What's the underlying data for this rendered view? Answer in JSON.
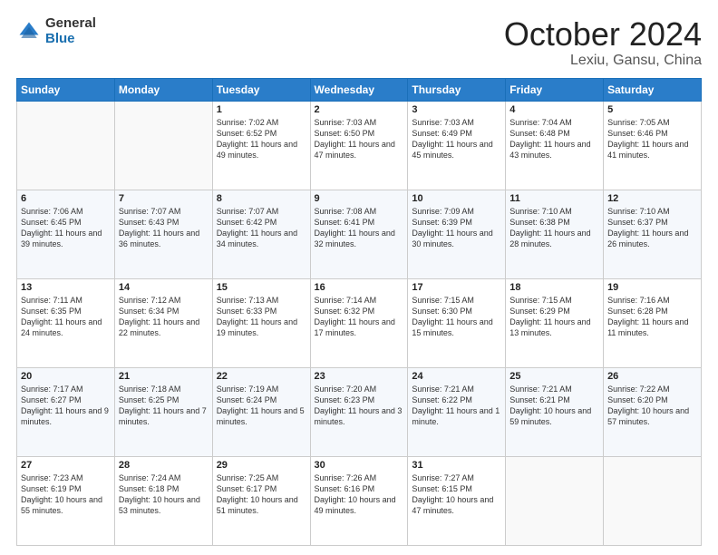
{
  "logo": {
    "general": "General",
    "blue": "Blue"
  },
  "header": {
    "month": "October 2024",
    "location": "Lexiu, Gansu, China"
  },
  "weekdays": [
    "Sunday",
    "Monday",
    "Tuesday",
    "Wednesday",
    "Thursday",
    "Friday",
    "Saturday"
  ],
  "weeks": [
    [
      {
        "day": "",
        "text": ""
      },
      {
        "day": "",
        "text": ""
      },
      {
        "day": "1",
        "text": "Sunrise: 7:02 AM\nSunset: 6:52 PM\nDaylight: 11 hours and 49 minutes."
      },
      {
        "day": "2",
        "text": "Sunrise: 7:03 AM\nSunset: 6:50 PM\nDaylight: 11 hours and 47 minutes."
      },
      {
        "day": "3",
        "text": "Sunrise: 7:03 AM\nSunset: 6:49 PM\nDaylight: 11 hours and 45 minutes."
      },
      {
        "day": "4",
        "text": "Sunrise: 7:04 AM\nSunset: 6:48 PM\nDaylight: 11 hours and 43 minutes."
      },
      {
        "day": "5",
        "text": "Sunrise: 7:05 AM\nSunset: 6:46 PM\nDaylight: 11 hours and 41 minutes."
      }
    ],
    [
      {
        "day": "6",
        "text": "Sunrise: 7:06 AM\nSunset: 6:45 PM\nDaylight: 11 hours and 39 minutes."
      },
      {
        "day": "7",
        "text": "Sunrise: 7:07 AM\nSunset: 6:43 PM\nDaylight: 11 hours and 36 minutes."
      },
      {
        "day": "8",
        "text": "Sunrise: 7:07 AM\nSunset: 6:42 PM\nDaylight: 11 hours and 34 minutes."
      },
      {
        "day": "9",
        "text": "Sunrise: 7:08 AM\nSunset: 6:41 PM\nDaylight: 11 hours and 32 minutes."
      },
      {
        "day": "10",
        "text": "Sunrise: 7:09 AM\nSunset: 6:39 PM\nDaylight: 11 hours and 30 minutes."
      },
      {
        "day": "11",
        "text": "Sunrise: 7:10 AM\nSunset: 6:38 PM\nDaylight: 11 hours and 28 minutes."
      },
      {
        "day": "12",
        "text": "Sunrise: 7:10 AM\nSunset: 6:37 PM\nDaylight: 11 hours and 26 minutes."
      }
    ],
    [
      {
        "day": "13",
        "text": "Sunrise: 7:11 AM\nSunset: 6:35 PM\nDaylight: 11 hours and 24 minutes."
      },
      {
        "day": "14",
        "text": "Sunrise: 7:12 AM\nSunset: 6:34 PM\nDaylight: 11 hours and 22 minutes."
      },
      {
        "day": "15",
        "text": "Sunrise: 7:13 AM\nSunset: 6:33 PM\nDaylight: 11 hours and 19 minutes."
      },
      {
        "day": "16",
        "text": "Sunrise: 7:14 AM\nSunset: 6:32 PM\nDaylight: 11 hours and 17 minutes."
      },
      {
        "day": "17",
        "text": "Sunrise: 7:15 AM\nSunset: 6:30 PM\nDaylight: 11 hours and 15 minutes."
      },
      {
        "day": "18",
        "text": "Sunrise: 7:15 AM\nSunset: 6:29 PM\nDaylight: 11 hours and 13 minutes."
      },
      {
        "day": "19",
        "text": "Sunrise: 7:16 AM\nSunset: 6:28 PM\nDaylight: 11 hours and 11 minutes."
      }
    ],
    [
      {
        "day": "20",
        "text": "Sunrise: 7:17 AM\nSunset: 6:27 PM\nDaylight: 11 hours and 9 minutes."
      },
      {
        "day": "21",
        "text": "Sunrise: 7:18 AM\nSunset: 6:25 PM\nDaylight: 11 hours and 7 minutes."
      },
      {
        "day": "22",
        "text": "Sunrise: 7:19 AM\nSunset: 6:24 PM\nDaylight: 11 hours and 5 minutes."
      },
      {
        "day": "23",
        "text": "Sunrise: 7:20 AM\nSunset: 6:23 PM\nDaylight: 11 hours and 3 minutes."
      },
      {
        "day": "24",
        "text": "Sunrise: 7:21 AM\nSunset: 6:22 PM\nDaylight: 11 hours and 1 minute."
      },
      {
        "day": "25",
        "text": "Sunrise: 7:21 AM\nSunset: 6:21 PM\nDaylight: 10 hours and 59 minutes."
      },
      {
        "day": "26",
        "text": "Sunrise: 7:22 AM\nSunset: 6:20 PM\nDaylight: 10 hours and 57 minutes."
      }
    ],
    [
      {
        "day": "27",
        "text": "Sunrise: 7:23 AM\nSunset: 6:19 PM\nDaylight: 10 hours and 55 minutes."
      },
      {
        "day": "28",
        "text": "Sunrise: 7:24 AM\nSunset: 6:18 PM\nDaylight: 10 hours and 53 minutes."
      },
      {
        "day": "29",
        "text": "Sunrise: 7:25 AM\nSunset: 6:17 PM\nDaylight: 10 hours and 51 minutes."
      },
      {
        "day": "30",
        "text": "Sunrise: 7:26 AM\nSunset: 6:16 PM\nDaylight: 10 hours and 49 minutes."
      },
      {
        "day": "31",
        "text": "Sunrise: 7:27 AM\nSunset: 6:15 PM\nDaylight: 10 hours and 47 minutes."
      },
      {
        "day": "",
        "text": ""
      },
      {
        "day": "",
        "text": ""
      }
    ]
  ]
}
